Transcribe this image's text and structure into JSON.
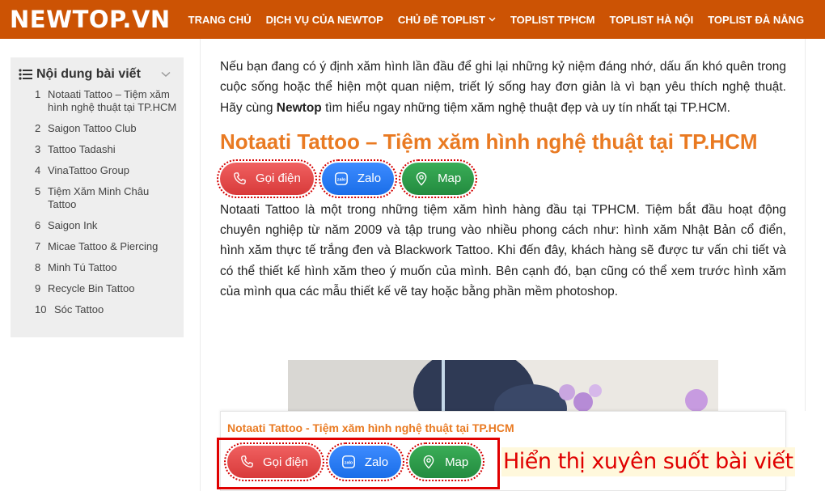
{
  "header": {
    "logo": "NEWTOP.VN",
    "nav": [
      {
        "label": "TRANG CHỦ",
        "dropdown": false
      },
      {
        "label": "DỊCH VỤ CỦA NEWTOP",
        "dropdown": false
      },
      {
        "label": "CHỦ ĐỀ TOPLIST",
        "dropdown": true
      },
      {
        "label": "TOPLIST TPHCM",
        "dropdown": false
      },
      {
        "label": "TOPLIST HÀ NỘI",
        "dropdown": false
      },
      {
        "label": "TOPLIST ĐÀ NẴNG",
        "dropdown": false
      }
    ]
  },
  "toc": {
    "title": "Nội dung bài viết",
    "items": [
      {
        "num": "1",
        "label": "Notaati Tattoo – Tiệm xăm hình nghệ thuật tại TP.HCM"
      },
      {
        "num": "2",
        "label": "Saigon Tattoo Club"
      },
      {
        "num": "3",
        "label": "Tattoo Tadashi"
      },
      {
        "num": "4",
        "label": "VinaTattoo Group"
      },
      {
        "num": "5",
        "label": "Tiệm Xăm Minh Châu Tattoo"
      },
      {
        "num": "6",
        "label": "Saigon Ink"
      },
      {
        "num": "7",
        "label": "Micae Tattoo & Piercing"
      },
      {
        "num": "8",
        "label": "Minh Tú Tattoo"
      },
      {
        "num": "9",
        "label": "Recycle Bin Tattoo"
      },
      {
        "num": "10",
        "label": "Sóc Tattoo"
      }
    ]
  },
  "article": {
    "intro_before": "Nếu bạn đang có ý định xăm hình lần đầu để ghi lại những kỷ niệm đáng nhớ, dấu ấn khó quên trong cuộc sống hoặc thể hiện một quan niệm, triết lý sống hay đơn giản là vì bạn yêu thích nghệ thuật. Hãy cùng ",
    "intro_bold": "Newtop",
    "intro_after": " tìm hiểu ngay những tiệm xăm nghệ thuật đẹp và uy tín nhất tại TP.HCM.",
    "heading": "Notaati Tattoo – Tiệm xăm hình nghệ thuật tại TP.HCM",
    "body": "Notaati Tattoo là một trong những tiệm xăm hình hàng đầu tại TPHCM. Tiệm bắt đầu hoạt động chuyên nghiệp từ năm 2009 và tập trung vào nhiều phong cách như: hình xăm Nhật Bản cổ điển, hình xăm thực tế trắng đen và Blackwork Tattoo. Khi đến đây, khách hàng sẽ được tư vấn chi tiết và có thể thiết kế hình xăm theo ý muốn của mình. Bên cạnh đó, bạn cũng có thể xem trước hình xăm của mình qua các mẫu thiết kế vẽ tay hoặc bằng phần mềm photoshop."
  },
  "buttons": {
    "call": "Gọi điện",
    "zalo": "Zalo",
    "map": "Map"
  },
  "sticky": {
    "title": "Notaati Tattoo - Tiệm xăm hình nghệ thuật tại TP.HCM"
  },
  "annotation": "Hiển thị xuyên suốt bài viết",
  "colors": {
    "brand": "#cc5304",
    "heading": "#e97a22",
    "call": "#e04848",
    "zalo": "#2a7cf5",
    "map": "#2e9c4b",
    "annotation": "#e00000"
  }
}
